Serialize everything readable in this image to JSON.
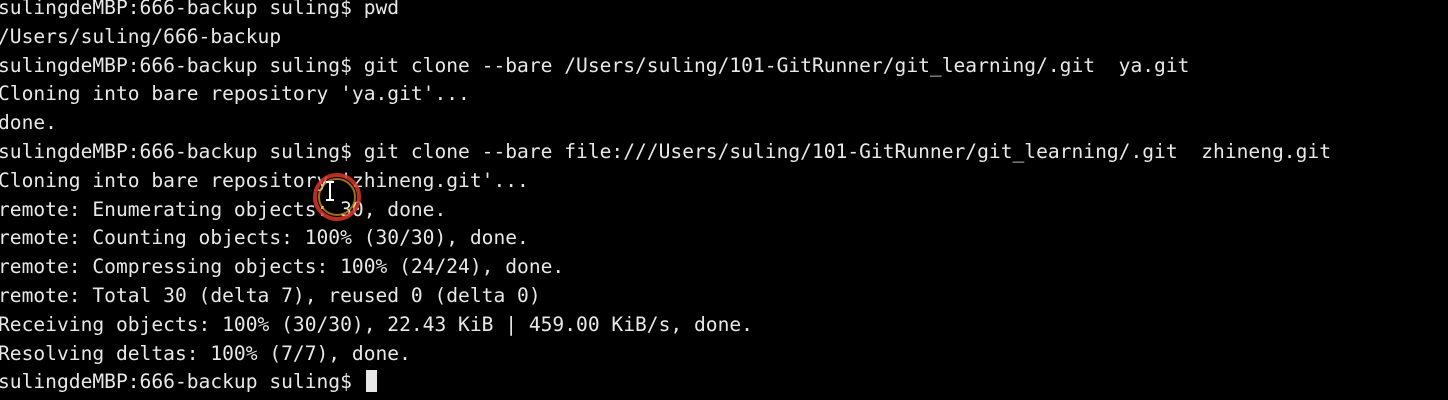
{
  "terminal": {
    "lines": [
      "sulingdeMBP:666-backup suling$ pwd",
      "/Users/suling/666-backup",
      "sulingdeMBP:666-backup suling$ git clone --bare /Users/suling/101-GitRunner/git_learning/.git  ya.git",
      "Cloning into bare repository 'ya.git'...",
      "done.",
      "sulingdeMBP:666-backup suling$ git clone --bare file:///Users/suling/101-GitRunner/git_learning/.git  zhineng.git",
      "Cloning into bare repository 'zhineng.git'...",
      "remote: Enumerating objects: 30, done.",
      "remote: Counting objects: 100% (30/30), done.",
      "remote: Compressing objects: 100% (24/24), done.",
      "remote: Total 30 (delta 7), reused 0 (delta 0)",
      "Receiving objects: 100% (30/30), 22.43 KiB | 459.00 KiB/s, done.",
      "Resolving deltas: 100% (7/7), done."
    ],
    "prompt": "sulingdeMBP:666-backup suling$ "
  },
  "colors": {
    "background": "#000000",
    "foreground": "#e8e8e8",
    "click_ring_outer": "#d8352a",
    "click_ring_inner": "#e0a020"
  },
  "icons": {
    "mouse": "text-cursor-with-click-ring-icon"
  }
}
